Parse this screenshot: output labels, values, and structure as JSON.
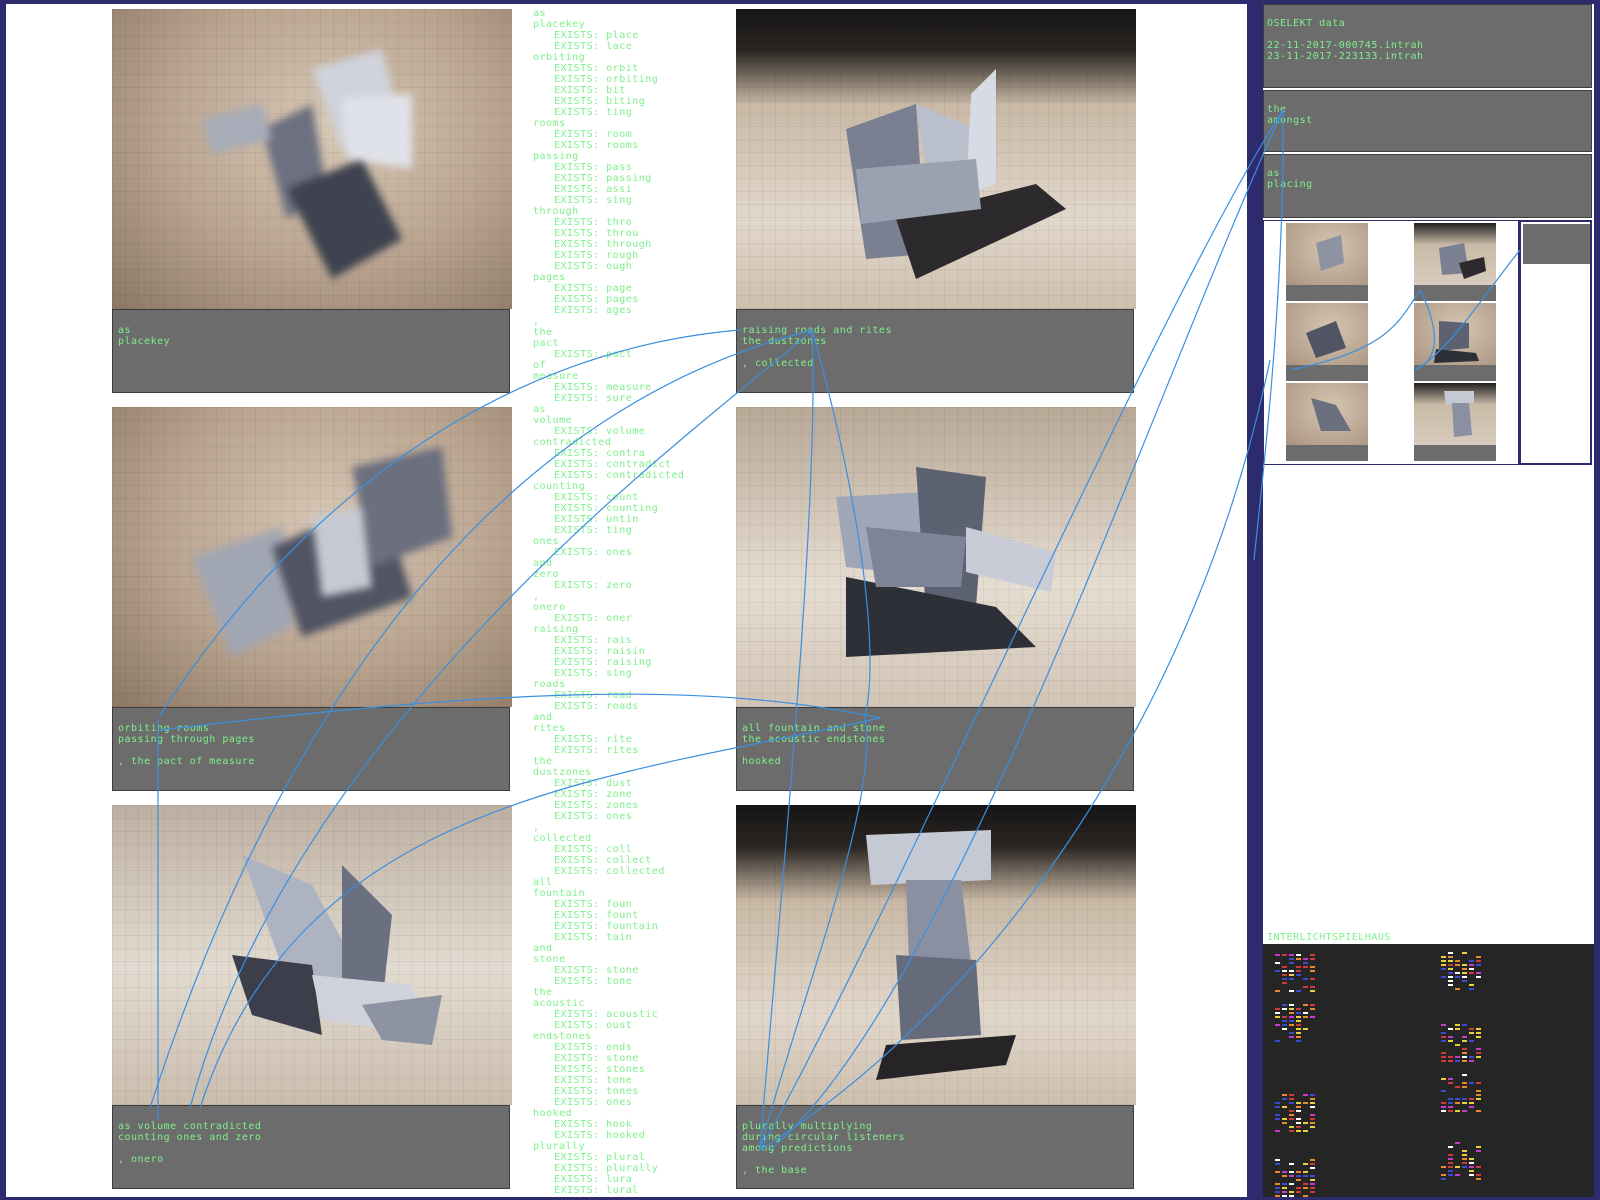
{
  "cards": [
    {
      "caption": [
        "as",
        "placekey"
      ],
      "photo": "blurred-paper-sculpture"
    },
    {
      "caption": [
        "raising roads and rites",
        "the dustzones",
        "",
        ", collected"
      ],
      "photo": "paper-sculpture-dark-backdrop"
    },
    {
      "caption": [
        "orbiting rooms",
        "passing through pages",
        "",
        ", the pact of measure"
      ],
      "photo": "blurred-paper-sculpture"
    },
    {
      "caption": [
        "all fountain and stone",
        "the acoustic endstones",
        "",
        "hooked"
      ],
      "photo": "paper-sculpture-crossed"
    },
    {
      "caption": [
        "as volume contradicted",
        "counting ones and zero",
        "",
        ", onero"
      ],
      "photo": "paper-sculpture-folded"
    },
    {
      "caption": [
        "plurally multiplying",
        "during circular listeners",
        "among predictions",
        "",
        ", the base"
      ],
      "photo": "paper-sculpture-tower"
    }
  ],
  "wordlist": [
    {
      "word": "as",
      "exists": []
    },
    {
      "word": "placekey",
      "exists": [
        "place",
        "lace"
      ]
    },
    {
      "word": "orbiting",
      "exists": [
        "orbit",
        "orbiting",
        "bit",
        "biting",
        "ting"
      ]
    },
    {
      "word": "rooms",
      "exists": [
        "room",
        "rooms"
      ]
    },
    {
      "word": "passing",
      "exists": [
        "pass",
        "passing",
        "assi",
        "sing"
      ]
    },
    {
      "word": "through",
      "exists": [
        "thro",
        "throu",
        "through",
        "rough",
        "ough"
      ]
    },
    {
      "word": "pages",
      "exists": [
        "page",
        "pages",
        "ages"
      ]
    },
    {
      "word": ",",
      "exists": []
    },
    {
      "word": "the",
      "exists": []
    },
    {
      "word": "pact",
      "exists": [
        "pact"
      ]
    },
    {
      "word": "of",
      "exists": []
    },
    {
      "word": "measure",
      "exists": [
        "measure",
        "sure"
      ]
    },
    {
      "word": "as",
      "exists": []
    },
    {
      "word": "volume",
      "exists": [
        "volume"
      ]
    },
    {
      "word": "contradicted",
      "exists": [
        "contra",
        "contradict",
        "contradicted"
      ]
    },
    {
      "word": "counting",
      "exists": [
        "count",
        "counting",
        "untin",
        "ting"
      ]
    },
    {
      "word": "ones",
      "exists": [
        "ones"
      ]
    },
    {
      "word": "and",
      "exists": []
    },
    {
      "word": "zero",
      "exists": [
        "zero"
      ]
    },
    {
      "word": ",",
      "exists": []
    },
    {
      "word": "onero",
      "exists": [
        "oner"
      ]
    },
    {
      "word": "raising",
      "exists": [
        "rais",
        "raisin",
        "raising",
        "sing"
      ]
    },
    {
      "word": "roads",
      "exists": [
        "road",
        "roads"
      ]
    },
    {
      "word": "and",
      "exists": []
    },
    {
      "word": "rites",
      "exists": [
        "rite",
        "rites"
      ]
    },
    {
      "word": "the",
      "exists": []
    },
    {
      "word": "dustzones",
      "exists": [
        "dust",
        "zone",
        "zones",
        "ones"
      ]
    },
    {
      "word": ",",
      "exists": []
    },
    {
      "word": "collected",
      "exists": [
        "coll",
        "collect",
        "collected"
      ]
    },
    {
      "word": "all",
      "exists": []
    },
    {
      "word": "fountain",
      "exists": [
        "foun",
        "fount",
        "fountain",
        "tain"
      ]
    },
    {
      "word": "and",
      "exists": []
    },
    {
      "word": "stone",
      "exists": [
        "stone",
        "tone"
      ]
    },
    {
      "word": "the",
      "exists": []
    },
    {
      "word": "acoustic",
      "exists": [
        "acoustic",
        "oust"
      ]
    },
    {
      "word": "endstones",
      "exists": [
        "ends",
        "stone",
        "stones",
        "tone",
        "tones",
        "ones"
      ]
    },
    {
      "word": "hooked",
      "exists": [
        "hook",
        "hooked"
      ]
    },
    {
      "word": "plurally",
      "exists": [
        "plural",
        "plurally",
        "lura",
        "lural"
      ]
    }
  ],
  "exists_prefix": "EXISTS: ",
  "right": {
    "select_title": "OSELEKT data",
    "dates": [
      "22-11-2017-000745.intrah",
      "23-11-2017-223133.intrah"
    ],
    "box2": [
      "the",
      "amongst"
    ],
    "box3": [
      "as",
      "placing"
    ],
    "stats_title": "INTERLICHTSPIELHAUS"
  },
  "colors": {
    "accent": "#2f8de0",
    "text": "#7ef08a",
    "frame": "#2e2a6e",
    "caption_bg": "#6c6c6c"
  }
}
